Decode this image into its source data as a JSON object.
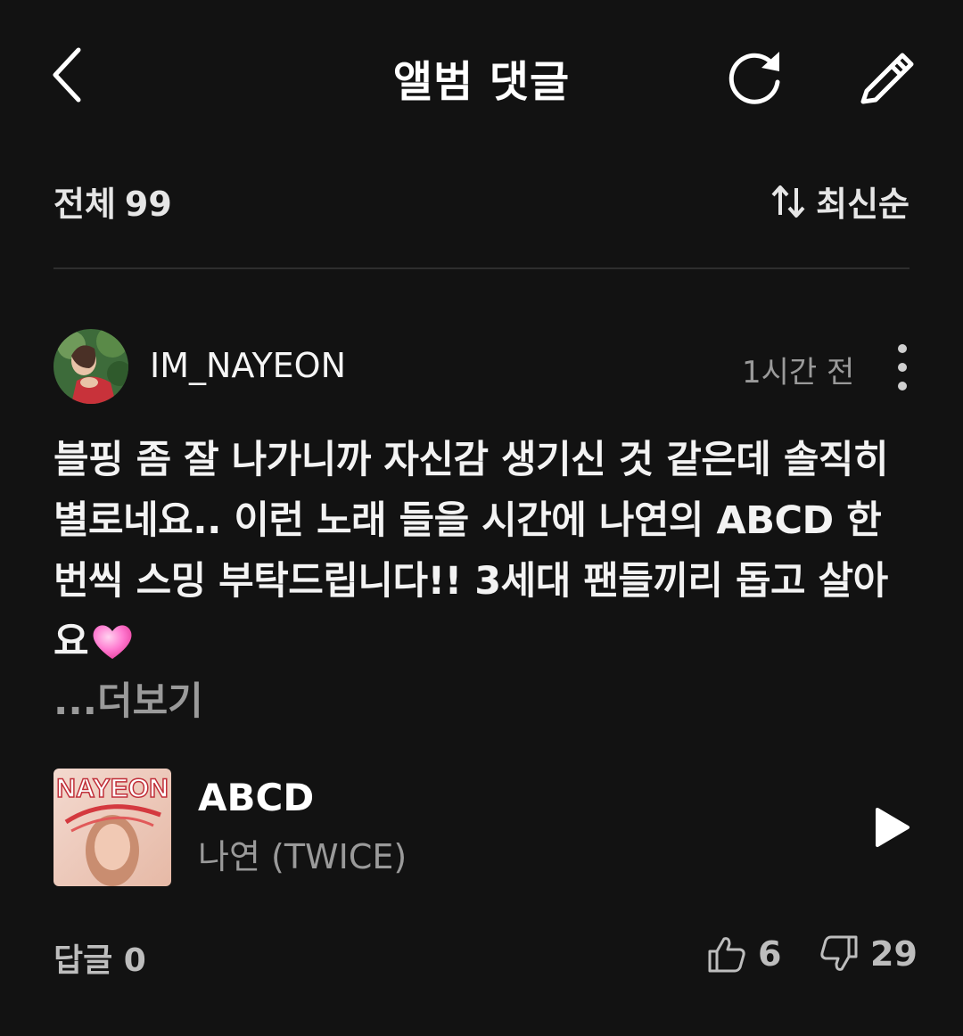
{
  "header": {
    "title": "앨범 댓글",
    "back_icon": "chevron-left-icon",
    "refresh_icon": "refresh-icon",
    "edit_icon": "pencil-icon"
  },
  "filter": {
    "total_label": "전체",
    "total_count": "99",
    "sort_label": "최신순",
    "sort_icon": "sort-arrows-icon"
  },
  "comment": {
    "username": "IM_NAYEON",
    "timestamp": "1시간 전",
    "text": "블핑 좀 잘 나가니까 자신감 생기신 것 같은데 솔직히 별로네요.. 이런 노래 들을 시간에 나연의 ABCD 한 번씩 스밍 부탁드립니다!! 3세대 팬들끼리 돕고 살아요",
    "emoji": "pink-heart-icon",
    "more_label": "...더보기"
  },
  "track": {
    "title": "ABCD",
    "artist": "나연 (TWICE)",
    "album_art_text": "NAYEON",
    "play_icon": "play-icon"
  },
  "footer": {
    "reply_label": "답글",
    "reply_count": "0",
    "likes": "6",
    "dislikes": "29",
    "like_icon": "thumbs-up-icon",
    "dislike_icon": "thumbs-down-icon"
  },
  "colors": {
    "background": "#121212",
    "text_primary": "#f2f2f2",
    "text_secondary": "#9a9a9a",
    "heart": "#ff7ad0"
  }
}
